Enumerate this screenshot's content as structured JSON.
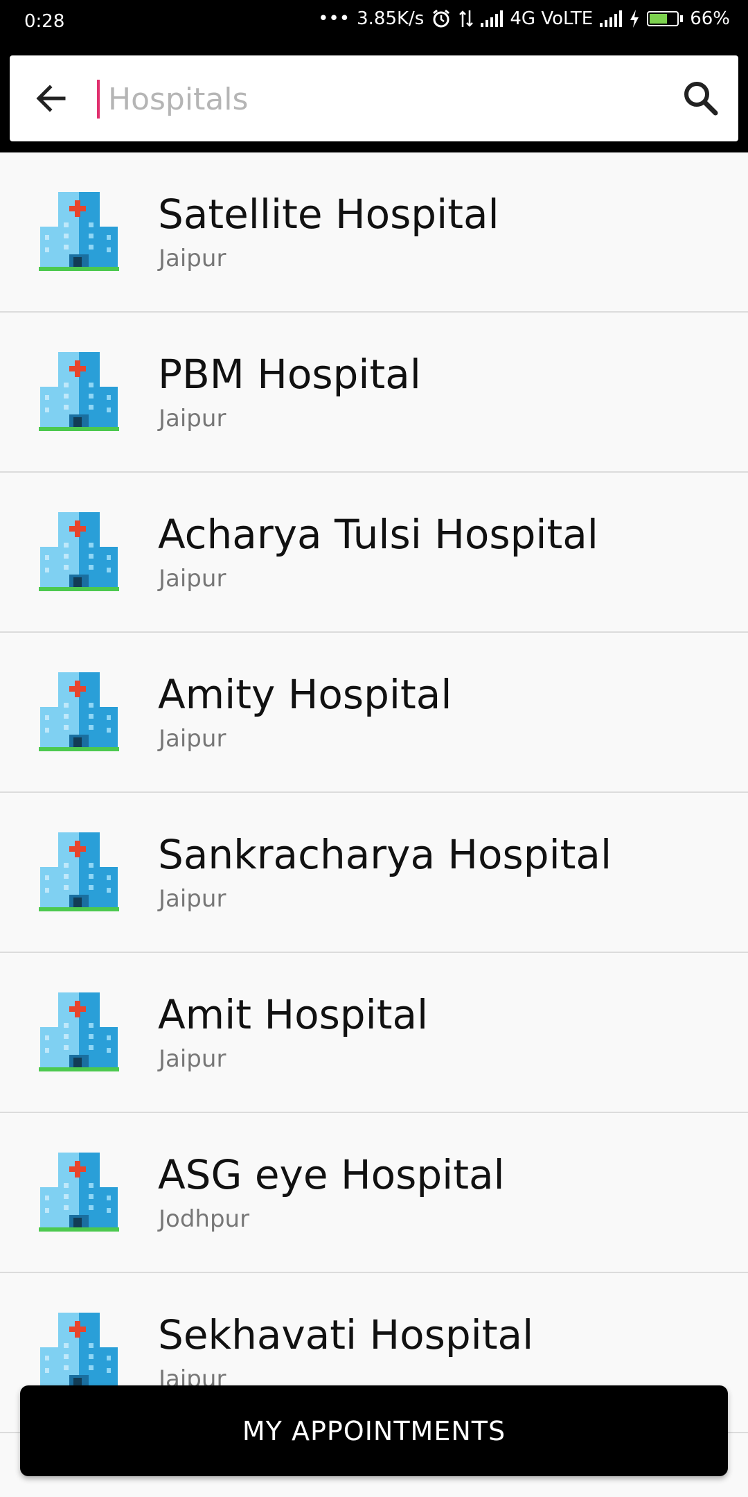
{
  "status_bar": {
    "time": "0:28",
    "net_speed": "3.85K/s",
    "network": "4G VoLTE",
    "battery": "66%",
    "battery_level": 0.66,
    "icons": [
      "dots-icon",
      "alarm-icon",
      "data-arrows-icon",
      "signal-icon",
      "signal-icon",
      "charging-icon",
      "battery-icon"
    ]
  },
  "search": {
    "placeholder": "Hospitals",
    "value": "",
    "back_icon": "arrow-left-icon",
    "search_icon": "magnifier-icon"
  },
  "hospitals": [
    {
      "name": "Satellite Hospital",
      "city": "Jaipur"
    },
    {
      "name": "PBM Hospital",
      "city": "Jaipur"
    },
    {
      "name": "Acharya Tulsi Hospital",
      "city": "Jaipur"
    },
    {
      "name": "Amity Hospital",
      "city": "Jaipur"
    },
    {
      "name": "Sankracharya Hospital",
      "city": "Jaipur"
    },
    {
      "name": "Amit Hospital",
      "city": "Jaipur"
    },
    {
      "name": "ASG eye Hospital",
      "city": "Jodhpur"
    },
    {
      "name": "Sekhavati Hospital",
      "city": "Jaipur"
    }
  ],
  "footer": {
    "appointments_label": "MY APPOINTMENTS"
  },
  "colors": {
    "accent_cursor": "#e0306e",
    "building_light": "#7fd0f2",
    "building_dark": "#2a9fd8",
    "ground": "#4cc94f",
    "cross": "#e8452c"
  }
}
